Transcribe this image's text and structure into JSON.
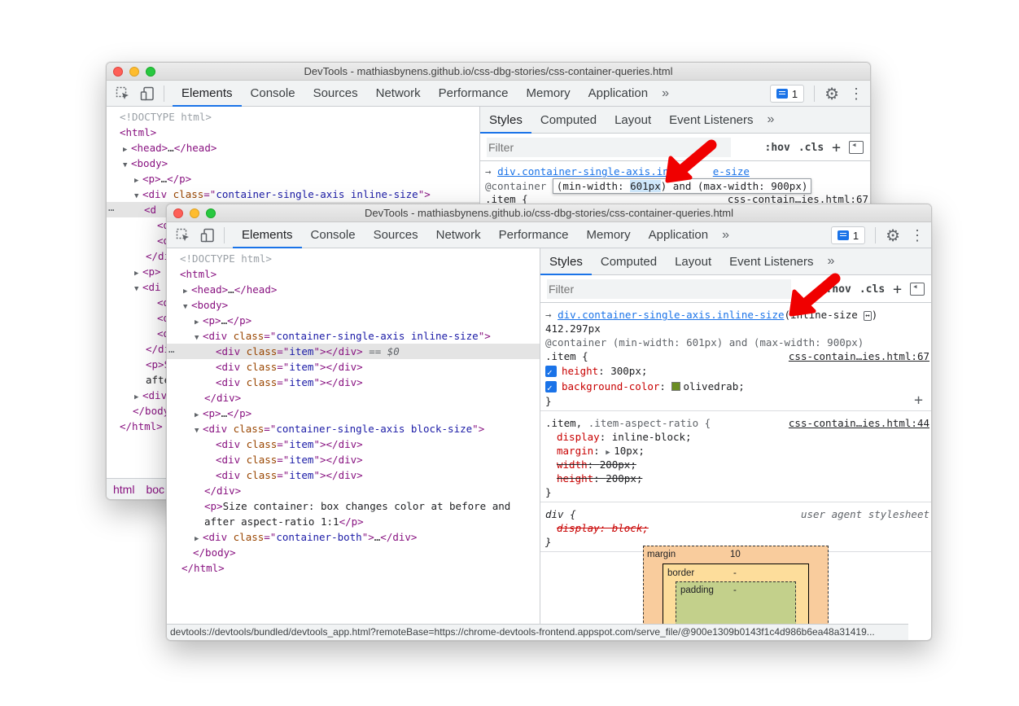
{
  "colors": {
    "accent": "#1a73e8",
    "arrow": "#f00000",
    "swatch": "#6b8e23"
  },
  "window_title": "DevTools - mathiasbynens.github.io/css-dbg-stories/css-container-queries.html",
  "main_tabs": [
    "Elements",
    "Console",
    "Sources",
    "Network",
    "Performance",
    "Memory",
    "Application"
  ],
  "more_tabs": "»",
  "issues_count": "1",
  "sub_tabs": [
    "Styles",
    "Computed",
    "Layout",
    "Event Listeners"
  ],
  "filter_placeholder": "Filter",
  "hov": ":hov",
  "cls": ".cls",
  "plus": "+",
  "back": {
    "dom": [
      "<!DOCTYPE html>",
      "<html>",
      "<head>",
      "</head>",
      "<body>",
      "<p>",
      "</p>",
      "<div",
      "class",
      "container-single-axis inline-size",
      ">",
      "<d",
      "<d",
      "<d",
      "</di",
      "<p>",
      "<di",
      "<d",
      "<d",
      "<d",
      "</di",
      "<p>S",
      "afte",
      "<div",
      "</body",
      "</html>"
    ],
    "crumbs": [
      "html",
      "boc"
    ],
    "rule_link": "div.container-single-axis.in",
    "rule_link_tail": "e-size",
    "container_prefix": "@container",
    "cq_part1": "(min-width: ",
    "cq_highlight": "601px",
    "cq_part2": ") and (max-width: 900px)",
    "item_selector": ".item {",
    "item_source": "css-contain…ies.html:67"
  },
  "front": {
    "dom": {
      "doctype": "<!DOCTYPE html>",
      "html_open": "<html>",
      "head": "<head>",
      "ellipsis": "…",
      "head_close": "</head>",
      "body_open": "<body>",
      "p_open": "<p>",
      "p_close": "</p>",
      "div_open": "<div ",
      "class_attr": "class",
      "eq_quote": "=\"",
      "quote_gt": "\">",
      "cls_inline": "container-single-axis inline-size",
      "cls_block": "container-single-axis block-size",
      "cls_both": "container-both",
      "cls_item": "item",
      "div_close": "</div>",
      "selected_suffix": "== $0",
      "p_text_1": "Size container: box changes color at before and",
      "p_text_2": "after aspect-ratio 1:1",
      "body_close": "</body>",
      "html_close": "</html>",
      "dots": "⋯"
    },
    "styles": {
      "arrow_prefix": "→",
      "rule_link": "div.container-single-axis.inline-size",
      "inline_size": "(inline-size",
      "size_value": "412.297px",
      "container_query": "@container (min-width: 601px) and (max-width: 900px)",
      "item_selector": ".item {",
      "item_source": "css-contain…ies.html:67",
      "height_prop": "height",
      "height_val": "300px;",
      "bg_prop": "background-color",
      "bg_val": "olivedrab;",
      "close_brace": "}",
      "aspect_selector_1": ".item,",
      "aspect_selector_2": ".item-aspect-ratio {",
      "aspect_source": "css-contain…ies.html:44",
      "display_prop": "display",
      "display_val": "inline-block;",
      "margin_prop": "margin",
      "margin_val": "10px;",
      "width_prop": "width",
      "width_val": "200px;",
      "height2_prop": "height",
      "height2_val": "200px;",
      "ua_selector": "div {",
      "ua_label": "user agent stylesheet",
      "ua_display": "display: block;"
    },
    "boxmodel": {
      "margin_label": "margin",
      "margin_value": "10",
      "border_label": "border",
      "border_value": "-",
      "padding_label": "padding",
      "padding_value": "-"
    },
    "status_url": "devtools://devtools/bundled/devtools_app.html?remoteBase=https://chrome-devtools-frontend.appspot.com/serve_file/@900e1309b0143f1c4d986b6ea48a31419..."
  }
}
